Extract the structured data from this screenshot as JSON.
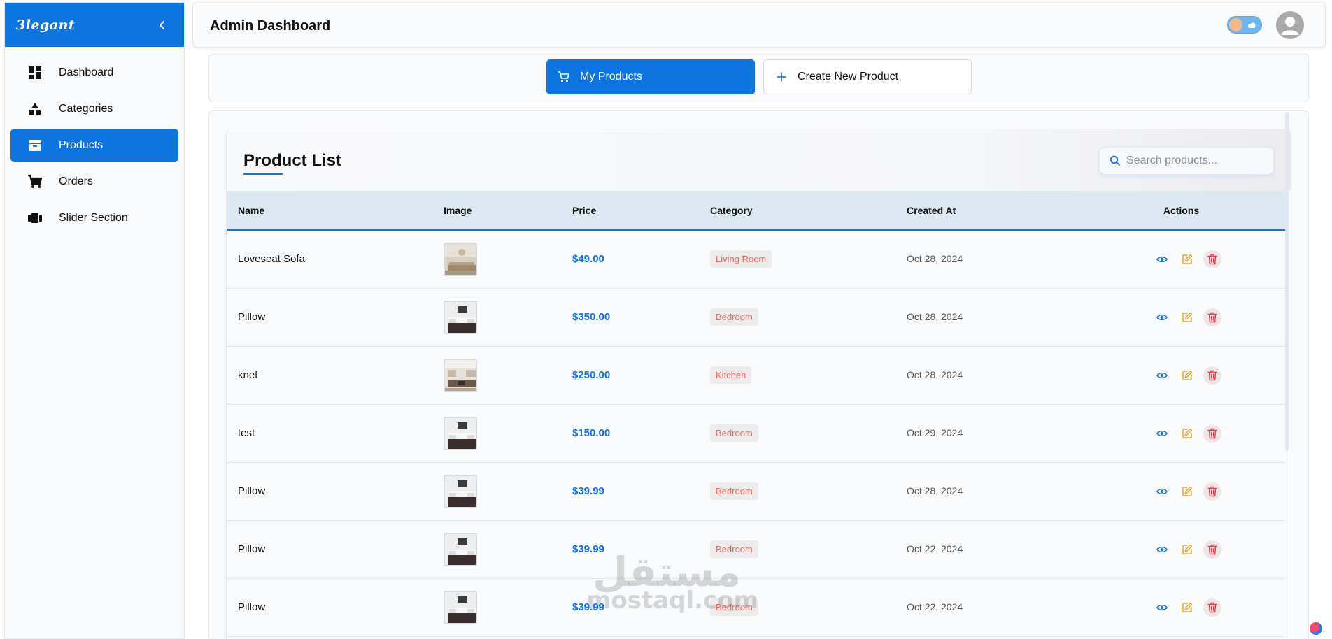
{
  "brand": {
    "logo": "3legant"
  },
  "sidebar": {
    "items": [
      {
        "label": "Dashboard",
        "icon": "dashboard-icon",
        "active": false
      },
      {
        "label": "Categories",
        "icon": "shapes-icon",
        "active": false
      },
      {
        "label": "Products",
        "icon": "archive-box-icon",
        "active": true
      },
      {
        "label": "Orders",
        "icon": "cart-icon",
        "active": false
      },
      {
        "label": "Slider Section",
        "icon": "carousel-icon",
        "active": false
      }
    ]
  },
  "header": {
    "title": "Admin Dashboard"
  },
  "tabs": {
    "my_products": "My Products",
    "create_new": "Create New Product"
  },
  "product_list": {
    "title": "Product List",
    "search_placeholder": "Search products...",
    "columns": {
      "name": "Name",
      "image": "Image",
      "price": "Price",
      "category": "Category",
      "created_at": "Created At",
      "actions": "Actions"
    },
    "rows": [
      {
        "name": "Loveseat Sofa",
        "image": "living-room-photo",
        "price": "$49.00",
        "category": "Living Room",
        "created_at": "Oct 28, 2024"
      },
      {
        "name": "Pillow",
        "image": "bedroom-photo",
        "price": "$350.00",
        "category": "Bedroom",
        "created_at": "Oct 28, 2024"
      },
      {
        "name": "knef",
        "image": "kitchen-photo",
        "price": "$250.00",
        "category": "Kitchen",
        "created_at": "Oct 28, 2024"
      },
      {
        "name": "test",
        "image": "bedroom-photo",
        "price": "$150.00",
        "category": "Bedroom",
        "created_at": "Oct 29, 2024"
      },
      {
        "name": "Pillow",
        "image": "bedroom-photo",
        "price": "$39.99",
        "category": "Bedroom",
        "created_at": "Oct 28, 2024"
      },
      {
        "name": "Pillow",
        "image": "bedroom-photo",
        "price": "$39.99",
        "category": "Bedroom",
        "created_at": "Oct 22, 2024"
      },
      {
        "name": "Pillow",
        "image": "bedroom-photo",
        "price": "$39.99",
        "category": "Bedroom",
        "created_at": "Oct 22, 2024"
      }
    ]
  },
  "watermark": {
    "arabic": "مستقل",
    "latin": "mostaql.com"
  },
  "colors": {
    "primary": "#0e74e0",
    "category_text": "#ef6a5e",
    "edit": "#f0a526",
    "delete": "#e0454d",
    "view": "#1a78c8"
  }
}
